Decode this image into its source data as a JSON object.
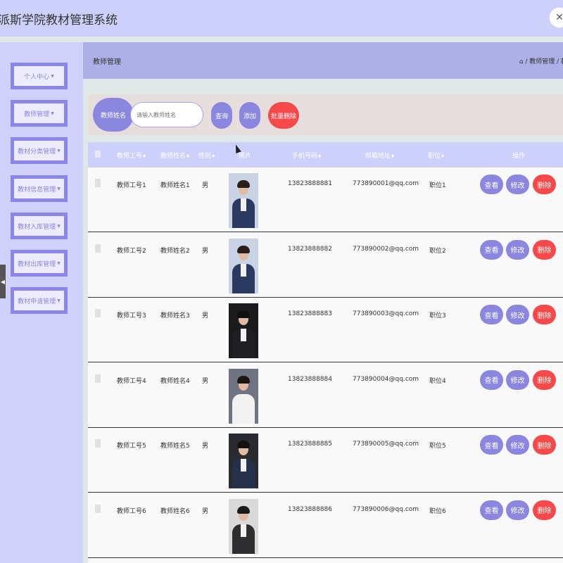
{
  "app": {
    "title": "派斯学院教材管理系统",
    "close_symbol": "✕"
  },
  "sidebar": {
    "items": [
      {
        "label": "个人中心"
      },
      {
        "label": "教师管理"
      },
      {
        "label": "教材分类管理"
      },
      {
        "label": "教材信息管理"
      },
      {
        "label": "教材入库管理"
      },
      {
        "label": "教材出库管理"
      },
      {
        "label": "教材申请管理"
      }
    ],
    "caret": "▼",
    "collapse_symbol": "◀"
  },
  "breadcrumb": {
    "title": "教师管理",
    "path": "⌂ / 教师管理 / 教"
  },
  "search": {
    "label": "教师姓名",
    "placeholder": "请输入教师姓名",
    "query_label": "查询",
    "add_label": "添加",
    "batch_delete_label": "批量删除"
  },
  "table": {
    "columns": [
      "教师工号",
      "教师姓名",
      "性别",
      "照片",
      "手机号码",
      "邮箱地址",
      "职位",
      "操作"
    ],
    "sort_symbol": "♦",
    "actions": {
      "view": "查看",
      "edit": "修改",
      "delete": "删除"
    },
    "rows": [
      {
        "id": "教师工号1",
        "name": "教师姓名1",
        "gender": "男",
        "phone": "13823888881",
        "email": "773890001@qq.com",
        "position": "职位1",
        "photo_bg": "#c9d3e3",
        "photo_body": "#2b3a60",
        "photo_hair": "#2a1e1a"
      },
      {
        "id": "教师工号2",
        "name": "教师姓名2",
        "gender": "男",
        "phone": "13823888882",
        "email": "773890002@qq.com",
        "position": "职位2",
        "photo_bg": "#c9d3e3",
        "photo_body": "#2b3a60",
        "photo_hair": "#2a1e1a"
      },
      {
        "id": "教师工号3",
        "name": "教师姓名3",
        "gender": "男",
        "phone": "13823888883",
        "email": "773890003@qq.com",
        "position": "职位3",
        "photo_bg": "#1b1b1e",
        "photo_body": "#1f1f24",
        "photo_hair": "#111111"
      },
      {
        "id": "教师工号4",
        "name": "教师姓名4",
        "gender": "男",
        "phone": "13823888884",
        "email": "773890004@qq.com",
        "position": "职位4",
        "photo_bg": "#6e7482",
        "photo_body": "#f2f2f2",
        "photo_hair": "#1e1612"
      },
      {
        "id": "教师工号5",
        "name": "教师姓名5",
        "gender": "男",
        "phone": "13823888885",
        "email": "773890005@qq.com",
        "position": "职位5",
        "photo_bg": "#2a2b30",
        "photo_body": "#26314b",
        "photo_hair": "#15110f"
      },
      {
        "id": "教师工号6",
        "name": "教师姓名6",
        "gender": "男",
        "phone": "13823888886",
        "email": "773890006@qq.com",
        "position": "职位6",
        "photo_bg": "#d9d9d9",
        "photo_body": "#2e2e30",
        "photo_hair": "#1b1b1b"
      }
    ]
  }
}
